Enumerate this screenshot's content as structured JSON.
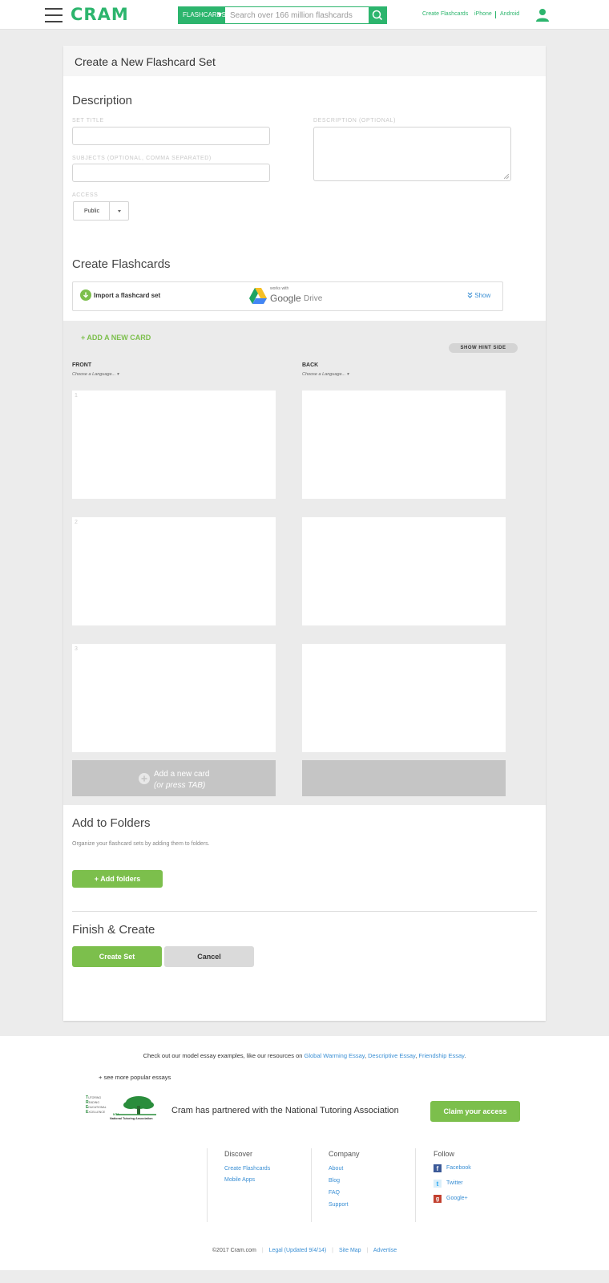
{
  "header": {
    "logo": "CRAM",
    "search": {
      "type_label": "FLASHCARDS",
      "placeholder": "Search over 166 million flashcards"
    },
    "links": {
      "create": "Create Flashcards",
      "iphone": "iPhone",
      "android": "Android"
    }
  },
  "form": {
    "title": "Create a New Flashcard Set",
    "description": {
      "heading": "Description",
      "set_title_label": "SET TITLE",
      "subjects_label": "SUBJECTS (OPTIONAL, COMMA SEPARATED)",
      "description_label": "DESCRIPTION (OPTIONAL)",
      "access_label": "ACCESS",
      "access_value": "Public"
    },
    "create_flashcards": {
      "heading": "Create Flashcards",
      "import_label": "Import a flashcard set",
      "drive_works_with": "works with",
      "drive_google": "Google",
      "drive_drive": "Drive",
      "show_label": "Show"
    },
    "cards": {
      "add_new_card": "+ ADD A NEW CARD",
      "show_hint": "SHOW HINT SIDE",
      "front_label": "FRONT",
      "back_label": "BACK",
      "choose_language": "Choose a Language...",
      "numbers": [
        "1",
        "2",
        "3"
      ],
      "add_card_label": "Add a new card",
      "add_card_hint": "(or press TAB)"
    },
    "folders": {
      "heading": "Add to Folders",
      "help": "Organize your flashcard sets by adding them to folders.",
      "button": "+ Add folders"
    },
    "finish": {
      "heading": "Finish & Create",
      "create_button": "Create Set",
      "cancel_button": "Cancel"
    }
  },
  "footer": {
    "essays_prefix": "Check out our model essay examples, like our resources on",
    "essay_links": [
      "Global Warming Essay",
      "Descriptive Essay",
      "Friendship Essay"
    ],
    "see_more": "+ see more popular essays",
    "partner_text": "Cram has partnered with the National Tutoring Association",
    "claim_button": "Claim your access",
    "nta_logo": {
      "t": "UTORING",
      "r": "EADING",
      "e": "DUCATIONAL",
      "x": "XCELLENCE",
      "abbr": "NTA",
      "name": "National Tutoring Association"
    },
    "discover": {
      "title": "Discover",
      "items": [
        "Create Flashcards",
        "Mobile Apps"
      ]
    },
    "company": {
      "title": "Company",
      "items": [
        "About",
        "Blog",
        "FAQ",
        "Support"
      ]
    },
    "follow": {
      "title": "Follow",
      "items": [
        "Facebook",
        "Twitter",
        "Google+"
      ]
    },
    "copyright": "©2017 Cram.com",
    "bottom_links": [
      "Legal (Updated 9/4/14)",
      "Site Map",
      "Advertise"
    ]
  }
}
